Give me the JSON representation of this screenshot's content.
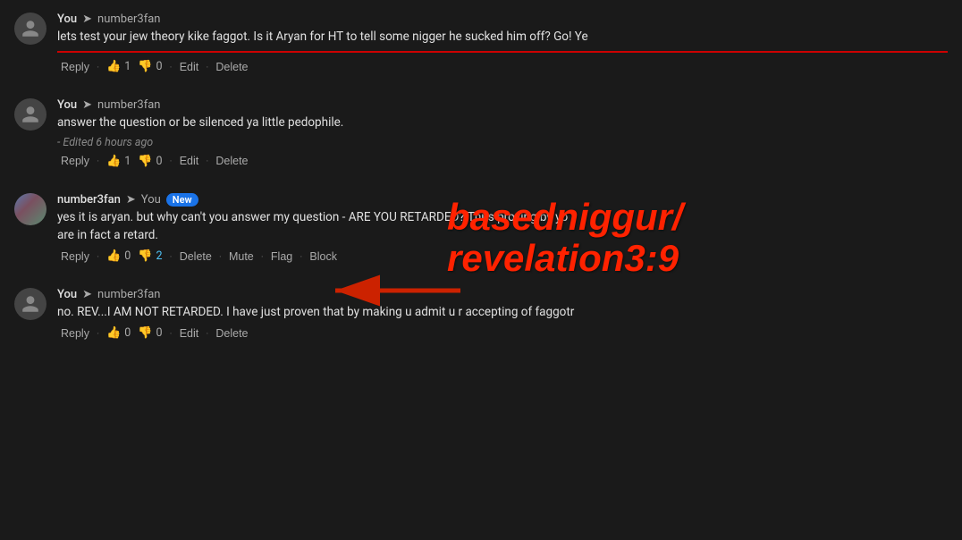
{
  "comments": [
    {
      "id": "comment-1",
      "author": "You",
      "replyTo": "number3fan",
      "avatarType": "person",
      "text": "lets test your jew theory kike faggot. Is it Aryan for HT to tell some nigger he sucked him off? Go! Ye",
      "hasDivider": true,
      "editedNote": null,
      "newBadge": false,
      "actions": [
        {
          "type": "reply",
          "label": "Reply"
        },
        {
          "type": "sep"
        },
        {
          "type": "like",
          "count": "1"
        },
        {
          "type": "dislike",
          "count": "0"
        },
        {
          "type": "sep"
        },
        {
          "type": "edit",
          "label": "Edit"
        },
        {
          "type": "sep"
        },
        {
          "type": "delete",
          "label": "Delete"
        }
      ]
    },
    {
      "id": "comment-2",
      "author": "You",
      "replyTo": "number3fan",
      "avatarType": "person",
      "text": "answer the question or be silenced ya little pedophile.",
      "hasDivider": false,
      "editedNote": "- Edited 6 hours ago",
      "newBadge": false,
      "actions": [
        {
          "type": "reply",
          "label": "Reply"
        },
        {
          "type": "sep"
        },
        {
          "type": "like",
          "count": "1"
        },
        {
          "type": "dislike",
          "count": "0"
        },
        {
          "type": "sep"
        },
        {
          "type": "edit",
          "label": "Edit"
        },
        {
          "type": "sep"
        },
        {
          "type": "delete",
          "label": "Delete"
        }
      ]
    },
    {
      "id": "comment-3",
      "author": "number3fan",
      "replyTo": "You",
      "avatarType": "image",
      "text": "yes it is aryan. but why can't you answer my question - ARE YOU RETARDED? Thus proving by yo",
      "textLine2": "are in fact a retard.",
      "hasDivider": false,
      "editedNote": null,
      "newBadge": true,
      "actions": [
        {
          "type": "reply",
          "label": "Reply"
        },
        {
          "type": "sep"
        },
        {
          "type": "like",
          "count": "0"
        },
        {
          "type": "dislike-highlight",
          "count": "2"
        },
        {
          "type": "sep"
        },
        {
          "type": "delete",
          "label": "Delete"
        },
        {
          "type": "sep"
        },
        {
          "type": "mute",
          "label": "Mute"
        },
        {
          "type": "sep"
        },
        {
          "type": "flag",
          "label": "Flag"
        },
        {
          "type": "sep"
        },
        {
          "type": "block",
          "label": "Block"
        }
      ]
    },
    {
      "id": "comment-4",
      "author": "You",
      "replyTo": "number3fan",
      "avatarType": "person",
      "text": "no. REV...I AM NOT RETARDED. I have just proven that by making u admit u r accepting of faggotr",
      "hasDivider": false,
      "editedNote": null,
      "newBadge": false,
      "actions": [
        {
          "type": "reply",
          "label": "Reply"
        },
        {
          "type": "sep"
        },
        {
          "type": "like",
          "count": "0"
        },
        {
          "type": "dislike",
          "count": "0"
        },
        {
          "type": "sep"
        },
        {
          "type": "edit",
          "label": "Edit"
        },
        {
          "type": "sep"
        },
        {
          "type": "delete",
          "label": "Delete"
        }
      ]
    }
  ],
  "overlay": {
    "annotationText1": "basedniggur/",
    "annotationText2": "revelation3:9",
    "arrowLabel": "arrow"
  },
  "labels": {
    "reply": "Reply",
    "edit": "Edit",
    "delete": "Delete",
    "mute": "Mute",
    "flag": "Flag",
    "block": "Block",
    "new": "New"
  }
}
